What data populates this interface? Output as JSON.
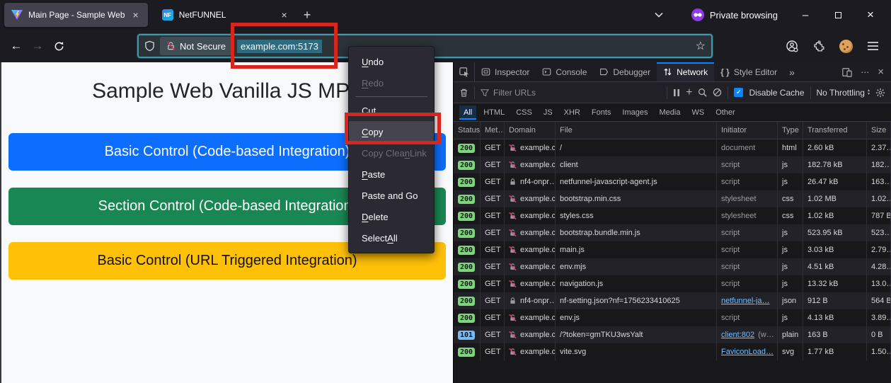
{
  "browser": {
    "tabs": [
      {
        "title": "Main Page - Sample Web"
      },
      {
        "title": "NetFUNNEL",
        "badge": "NF"
      }
    ],
    "new_tab_label": "+",
    "private_label": "Private browsing",
    "urlbar": {
      "not_secure_label": "Not Secure",
      "address": "example.com:5173"
    }
  },
  "context_menu": {
    "items": [
      {
        "label": "Undo",
        "key": "U",
        "state": "normal"
      },
      {
        "label": "Redo",
        "key": "R",
        "state": "disabled"
      },
      {
        "separator": true
      },
      {
        "label": "Cut",
        "key": "t",
        "state": "normal"
      },
      {
        "label": "Copy",
        "key": "C",
        "state": "highlight"
      },
      {
        "label": "Copy Clean Link",
        "key": "n",
        "state": "disabled"
      },
      {
        "label": "Paste",
        "key": "P",
        "state": "normal"
      },
      {
        "label": "Paste and Go",
        "key": "",
        "state": "normal"
      },
      {
        "label": "Delete",
        "key": "D",
        "state": "normal"
      },
      {
        "label": "Select All",
        "key": "A",
        "state": "normal"
      }
    ]
  },
  "page": {
    "title": "Sample Web Vanilla JS MPA",
    "buttons": [
      {
        "label": "Basic Control (Code-based Integration)",
        "color": "#0d6efd",
        "text_color": "#ffffff"
      },
      {
        "label": "Section Control (Code-based Integration)",
        "color": "#198754",
        "text_color": "#ffffff"
      },
      {
        "label": "Basic Control (URL Triggered Integration)",
        "color": "#ffc107",
        "text_color": "#111111"
      }
    ]
  },
  "devtools": {
    "tabs": [
      "Inspector",
      "Console",
      "Debugger",
      "Network",
      "Style Editor"
    ],
    "active_tab": "Network",
    "toolbar": {
      "filter_placeholder": "Filter URLs",
      "disable_cache_label": "Disable Cache",
      "disable_cache_checked": true,
      "throttling_value": "No Throttling"
    },
    "filters": [
      "All",
      "HTML",
      "CSS",
      "JS",
      "XHR",
      "Fonts",
      "Images",
      "Media",
      "WS",
      "Other"
    ],
    "active_filter": "All",
    "columns": [
      "Status",
      "Met…",
      "Domain",
      "File",
      "Initiator",
      "Type",
      "Transferred",
      "Size"
    ],
    "requests": [
      {
        "status": "200",
        "method": "GET",
        "domain": "example.c…",
        "lock": "insecure",
        "file": "/",
        "initiator": "document",
        "initiator_link": false,
        "initiator_extra": "",
        "type": "html",
        "transferred": "2.60 kB",
        "size": "2.37…"
      },
      {
        "status": "200",
        "method": "GET",
        "domain": "example.c…",
        "lock": "insecure",
        "file": "client",
        "initiator": "script",
        "initiator_link": false,
        "initiator_extra": "",
        "type": "js",
        "transferred": "182.78 kB",
        "size": "182…"
      },
      {
        "status": "200",
        "method": "GET",
        "domain": "nf4-onpr…",
        "lock": "secure",
        "file": "netfunnel-javascript-agent.js",
        "initiator": "script",
        "initiator_link": false,
        "initiator_extra": "",
        "type": "js",
        "transferred": "26.47 kB",
        "size": "163…"
      },
      {
        "status": "200",
        "method": "GET",
        "domain": "example.c…",
        "lock": "insecure",
        "file": "bootstrap.min.css",
        "initiator": "stylesheet",
        "initiator_link": false,
        "initiator_extra": "",
        "type": "css",
        "transferred": "1.02 MB",
        "size": "1.02…"
      },
      {
        "status": "200",
        "method": "GET",
        "domain": "example.c…",
        "lock": "insecure",
        "file": "styles.css",
        "initiator": "stylesheet",
        "initiator_link": false,
        "initiator_extra": "",
        "type": "css",
        "transferred": "1.02 kB",
        "size": "787 B"
      },
      {
        "status": "200",
        "method": "GET",
        "domain": "example.c…",
        "lock": "insecure",
        "file": "bootstrap.bundle.min.js",
        "initiator": "script",
        "initiator_link": false,
        "initiator_extra": "",
        "type": "js",
        "transferred": "523.95 kB",
        "size": "523…"
      },
      {
        "status": "200",
        "method": "GET",
        "domain": "example.c…",
        "lock": "insecure",
        "file": "main.js",
        "initiator": "script",
        "initiator_link": false,
        "initiator_extra": "",
        "type": "js",
        "transferred": "3.03 kB",
        "size": "2.79…"
      },
      {
        "status": "200",
        "method": "GET",
        "domain": "example.c…",
        "lock": "insecure",
        "file": "env.mjs",
        "initiator": "script",
        "initiator_link": false,
        "initiator_extra": "",
        "type": "js",
        "transferred": "4.51 kB",
        "size": "4.28…"
      },
      {
        "status": "200",
        "method": "GET",
        "domain": "example.c…",
        "lock": "insecure",
        "file": "navigation.js",
        "initiator": "script",
        "initiator_link": false,
        "initiator_extra": "",
        "type": "js",
        "transferred": "13.32 kB",
        "size": "13.0…"
      },
      {
        "status": "200",
        "method": "GET",
        "domain": "nf4-onpr…",
        "lock": "secure",
        "file": "nf-setting.json?nf=1756233410625",
        "initiator": "netfunnel-ja…",
        "initiator_link": true,
        "initiator_extra": "",
        "type": "json",
        "transferred": "912 B",
        "size": "564 B"
      },
      {
        "status": "200",
        "method": "GET",
        "domain": "example.c…",
        "lock": "insecure",
        "file": "env.js",
        "initiator": "script",
        "initiator_link": false,
        "initiator_extra": "",
        "type": "js",
        "transferred": "4.13 kB",
        "size": "3.89…"
      },
      {
        "status": "101",
        "method": "GET",
        "domain": "example.c…",
        "lock": "insecure",
        "file": "/?token=gmTKU3wsYalt",
        "initiator": "client:802",
        "initiator_link": true,
        "initiator_extra": " (w…",
        "type": "plain",
        "transferred": "163 B",
        "size": "0 B"
      },
      {
        "status": "200",
        "method": "GET",
        "domain": "example.c…",
        "lock": "insecure",
        "file": "vite.svg",
        "initiator": "FaviconLoad…",
        "initiator_link": true,
        "initiator_extra": "",
        "type": "svg",
        "transferred": "1.77 kB",
        "size": "1.50…"
      }
    ]
  },
  "colors": {
    "accent_blue": "#0a84ff",
    "annotation_red": "#d7261d",
    "status_ok": "#7cd67c",
    "status_switching": "#79b8f3",
    "link": "#75bfff",
    "url_selection": "#2e6b7e"
  }
}
